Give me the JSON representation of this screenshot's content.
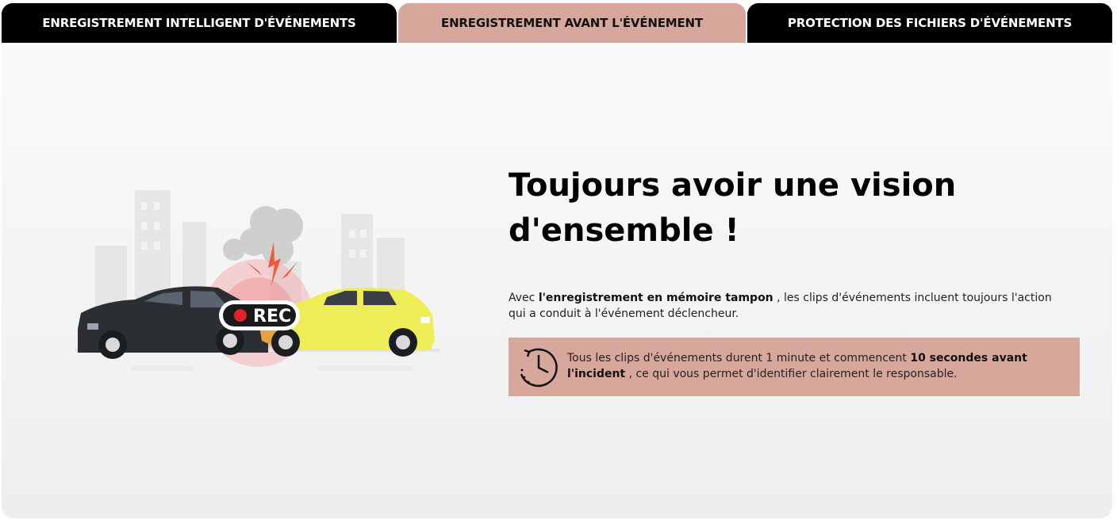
{
  "tabs": [
    {
      "label": "ENREGISTREMENT INTELLIGENT D'ÉVÉNEMENTS",
      "active": false
    },
    {
      "label": "ENREGISTREMENT AVANT L'ÉVÉNEMENT",
      "active": true
    },
    {
      "label": "PROTECTION DES FICHIERS D'ÉVÉNEMENTS",
      "active": false
    }
  ],
  "illustration": {
    "rec_label": "REC"
  },
  "content": {
    "title": "Toujours avoir une vision d'ensemble !",
    "desc_pre": "Avec ",
    "desc_bold": "l'enregistrement en mémoire tampon",
    "desc_post": " , les clips d'événements incluent toujours l'action qui a conduit à l'événement déclencheur.",
    "info_pre": "Tous les clips d'événements durent 1 minute et commencent ",
    "info_bold": "10 secondes avant l'incident",
    "info_post": " , ce qui vous permet d'identifier clairement le responsable."
  },
  "colors": {
    "accent": "#d8a79c",
    "tab_dark": "#000000",
    "car_dark": "#2b2f33",
    "car_yellow": "#eded57",
    "rec_red": "#e0242e"
  },
  "icons": [
    "clock-history-icon"
  ]
}
